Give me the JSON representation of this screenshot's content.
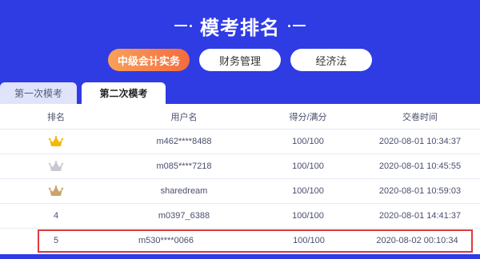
{
  "header": {
    "title": "模考排名"
  },
  "categories": [
    {
      "label": "中级会计实务",
      "active": true
    },
    {
      "label": "财务管理",
      "active": false
    },
    {
      "label": "经济法",
      "active": false
    }
  ],
  "tabs": [
    {
      "label": "第一次模考",
      "active": false
    },
    {
      "label": "第二次模考",
      "active": true
    }
  ],
  "table": {
    "columns": [
      "排名",
      "用户名",
      "得分/满分",
      "交卷时间"
    ],
    "rows": [
      {
        "rank": "",
        "rank_icon": "gold-crown-icon",
        "user": "m462****8488",
        "score": "100/100",
        "time": "2020-08-01 10:34:37"
      },
      {
        "rank": "",
        "rank_icon": "silver-crown-icon",
        "user": "m085****7218",
        "score": "100/100",
        "time": "2020-08-01 10:45:55"
      },
      {
        "rank": "",
        "rank_icon": "bronze-crown-icon",
        "user": "sharedream",
        "score": "100/100",
        "time": "2020-08-01 10:59:03"
      },
      {
        "rank": "4",
        "user": "m0397_6388",
        "score": "100/100",
        "time": "2020-08-01 14:41:37"
      },
      {
        "rank": "5",
        "user": "m530****0066",
        "score": "100/100",
        "time": "2020-08-02 00:10:34"
      }
    ]
  },
  "colors": {
    "background": "#2f3be3",
    "accent_orange": "#f36c3d",
    "gold": "#f5b800",
    "silver": "#c8c8d0",
    "bronze": "#c9a56b",
    "highlight_border": "#e03a3a"
  }
}
